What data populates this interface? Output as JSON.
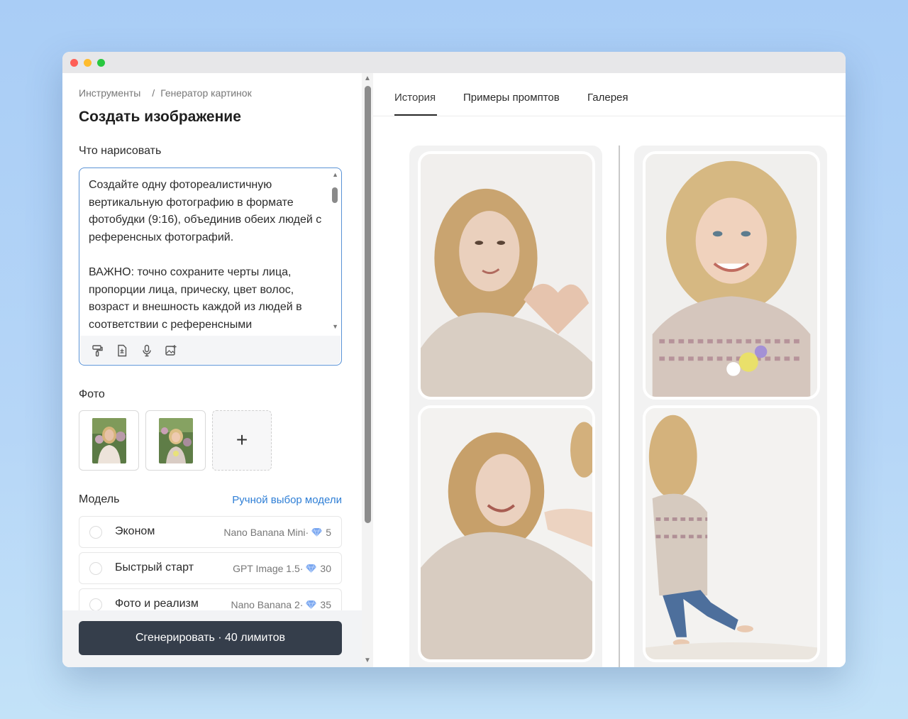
{
  "breadcrumb": {
    "root": "Инструменты",
    "separator": "/",
    "current": "Генератор картинок"
  },
  "page_title": "Создать изображение",
  "prompt": {
    "label": "Что нарисовать",
    "text": "Создайте одну фотореалистичную вертикальную фотографию в формате фотобудки (9:16), объединив обеих людей с референсных фотографий.\n\nВАЖНО: точно сохраните черты лица, пропорции лица, прическу, цвет волос, возраст и внешность каждой из людей в соответствии с референсными",
    "tools": [
      "paint-roller-icon",
      "file-text-icon",
      "microphone-icon",
      "image-add-icon"
    ]
  },
  "photos": {
    "label": "Фото",
    "add_symbol": "+"
  },
  "model": {
    "label": "Модель",
    "manual_link": "Ручной выбор модели",
    "options": [
      {
        "name": "Эконом",
        "engine": "Nano Banana Mini·",
        "cost": "5"
      },
      {
        "name": "Быстрый старт",
        "engine": "GPT Image 1.5·",
        "cost": "30"
      },
      {
        "name": "Фото и реализм",
        "engine": "Nano Banana 2·",
        "cost": "35"
      }
    ]
  },
  "generate_button": "Сгенерировать · 40 лимитов",
  "tabs": [
    {
      "label": "История",
      "active": true
    },
    {
      "label": "Примеры промптов",
      "active": false
    },
    {
      "label": "Галерея",
      "active": false
    }
  ],
  "colors": {
    "accent_link": "#2f7fd6",
    "button_bg": "#353e4b",
    "prompt_border": "#5a93d6",
    "gem": "#7aa7f0"
  }
}
